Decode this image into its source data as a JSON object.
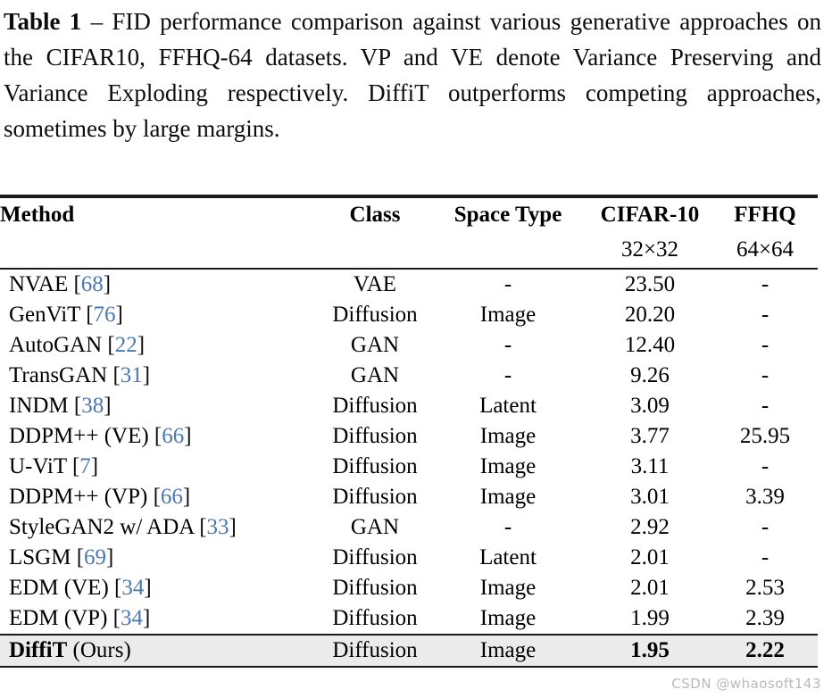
{
  "caption": {
    "label": "Table 1",
    "dash": " – ",
    "body": "FID performance comparison against various generative approaches on the CIFAR10, FFHQ-64 datasets. VP and VE denote Variance Preserving and Variance Exploding respectively. DiffiT outperforms competing approaches, sometimes by large margins."
  },
  "table": {
    "headers": {
      "method": "Method",
      "class": "Class",
      "space_type": "Space Type",
      "cifar": "CIFAR-10",
      "cifar_sub": "32×32",
      "ffhq": "FFHQ",
      "ffhq_sub": "64×64"
    },
    "rows": [
      {
        "method": "NVAE",
        "cite": "68",
        "class": "VAE",
        "space": "-",
        "cifar": "23.50",
        "ffhq": "-",
        "highlight": false
      },
      {
        "method": "GenViT",
        "cite": "76",
        "class": "Diffusion",
        "space": "Image",
        "cifar": "20.20",
        "ffhq": "-",
        "highlight": false
      },
      {
        "method": "AutoGAN",
        "cite": "22",
        "class": "GAN",
        "space": "-",
        "cifar": "12.40",
        "ffhq": "-",
        "highlight": false
      },
      {
        "method": "TransGAN",
        "cite": "31",
        "class": "GAN",
        "space": "-",
        "cifar": "9.26",
        "ffhq": "-",
        "highlight": false
      },
      {
        "method": "INDM",
        "cite": "38",
        "class": "Diffusion",
        "space": "Latent",
        "cifar": "3.09",
        "ffhq": "-",
        "highlight": false
      },
      {
        "method": "DDPM++ (VE)",
        "cite": "66",
        "class": "Diffusion",
        "space": "Image",
        "cifar": "3.77",
        "ffhq": "25.95",
        "highlight": false
      },
      {
        "method": "U-ViT",
        "cite": "7",
        "class": "Diffusion",
        "space": "Image",
        "cifar": "3.11",
        "ffhq": "-",
        "highlight": false
      },
      {
        "method": "DDPM++ (VP)",
        "cite": "66",
        "class": "Diffusion",
        "space": "Image",
        "cifar": "3.01",
        "ffhq": "3.39",
        "highlight": false
      },
      {
        "method": "StyleGAN2 w/ ADA",
        "cite": "33",
        "class": "GAN",
        "space": "-",
        "cifar": "2.92",
        "ffhq": "-",
        "highlight": false
      },
      {
        "method": "LSGM",
        "cite": "69",
        "class": "Diffusion",
        "space": "Latent",
        "cifar": "2.01",
        "ffhq": "-",
        "highlight": false
      },
      {
        "method": "EDM (VE)",
        "cite": "34",
        "class": "Diffusion",
        "space": "Image",
        "cifar": "2.01",
        "ffhq": "2.53",
        "highlight": false
      },
      {
        "method": "EDM (VP)",
        "cite": "34",
        "class": "Diffusion",
        "space": "Image",
        "cifar": "1.99",
        "ffhq": "2.39",
        "highlight": false
      },
      {
        "method": "DiffiT",
        "suffix": " (Ours)",
        "cite": "",
        "class": "Diffusion",
        "space": "Image",
        "cifar": "1.95",
        "ffhq": "2.22",
        "highlight": true
      }
    ]
  },
  "watermark": {
    "text": "CSDN @whaosoft143"
  },
  "colors": {
    "citation_blue": "#4a78b0",
    "rule": "#1a1a1a",
    "highlight_row": "#ebebeb",
    "watermark": "#b9b9b9",
    "page_background": "#ffffff"
  }
}
